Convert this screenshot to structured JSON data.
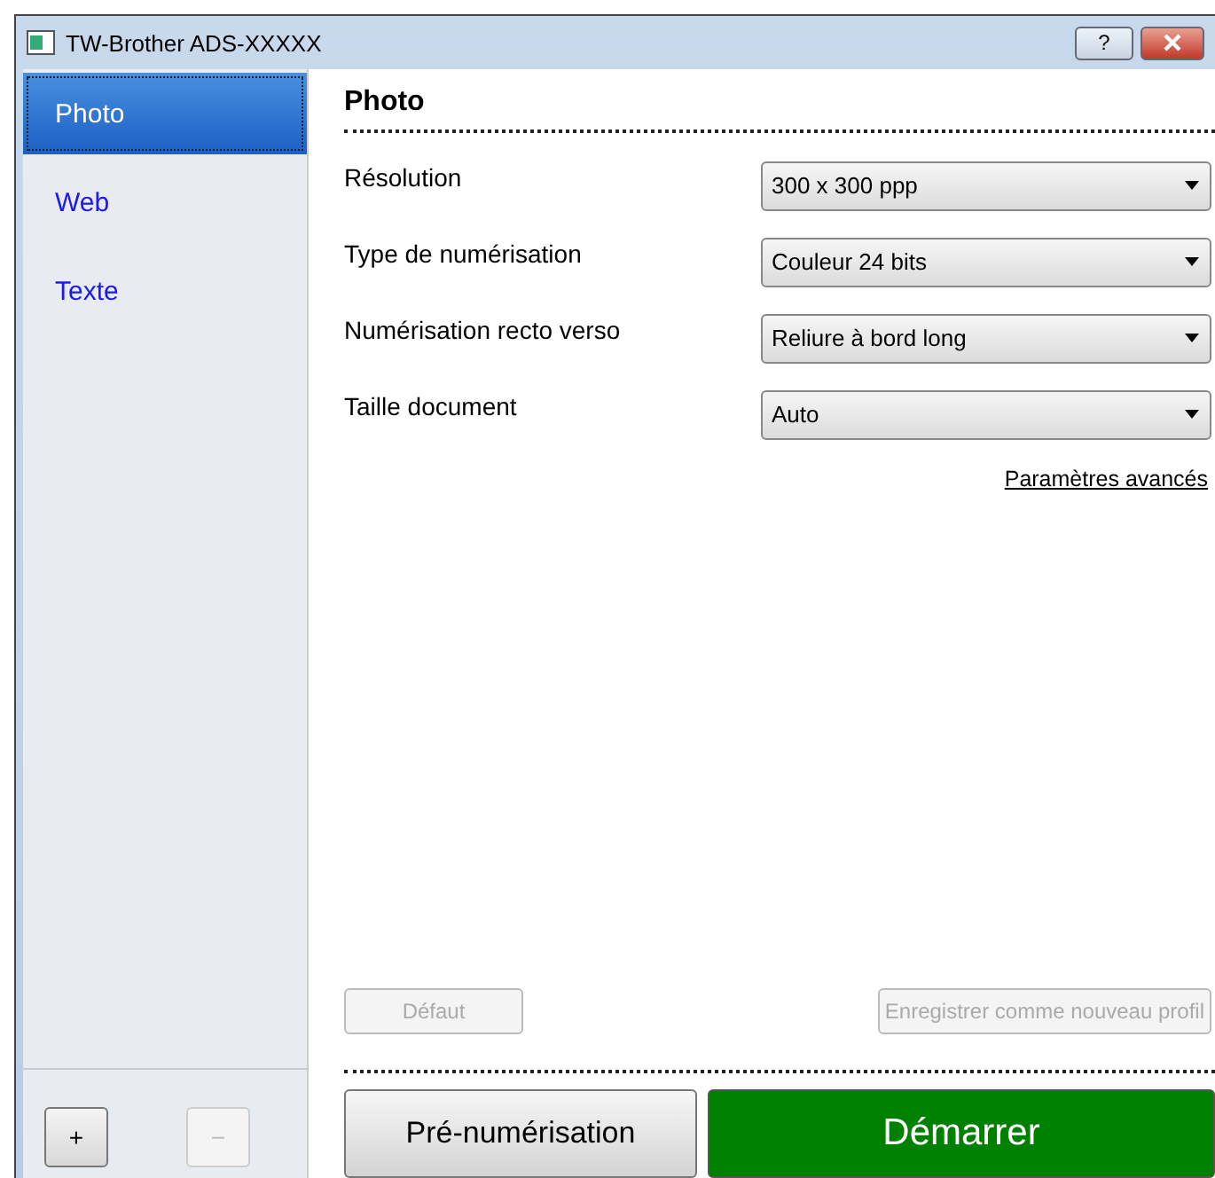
{
  "window": {
    "title": "TW-Brother ADS-XXXXX",
    "help_button": "?"
  },
  "sidebar": {
    "items": [
      {
        "label": "Photo",
        "selected": true
      },
      {
        "label": "Web",
        "selected": false
      },
      {
        "label": "Texte",
        "selected": false
      }
    ],
    "add_button": {
      "label": "+",
      "disabled": false
    },
    "remove_button": {
      "label": "−",
      "disabled": true
    }
  },
  "panel": {
    "title": "Photo",
    "settings": [
      {
        "label": "Résolution",
        "value": "300 x 300 ppp"
      },
      {
        "label": "Type de numérisation",
        "value": "Couleur 24 bits"
      },
      {
        "label": "Numérisation recto verso",
        "value": "Reliure à bord long"
      },
      {
        "label": "Taille document",
        "value": "Auto"
      }
    ],
    "advanced_link": "Paramètres avancés",
    "default_button": {
      "label": "Défaut",
      "disabled": true
    },
    "save_profile_button": {
      "label": "Enregistrer comme nouveau profil",
      "disabled": true
    },
    "prescan_button": "Pré-numérisation",
    "start_button": "Démarrer"
  }
}
